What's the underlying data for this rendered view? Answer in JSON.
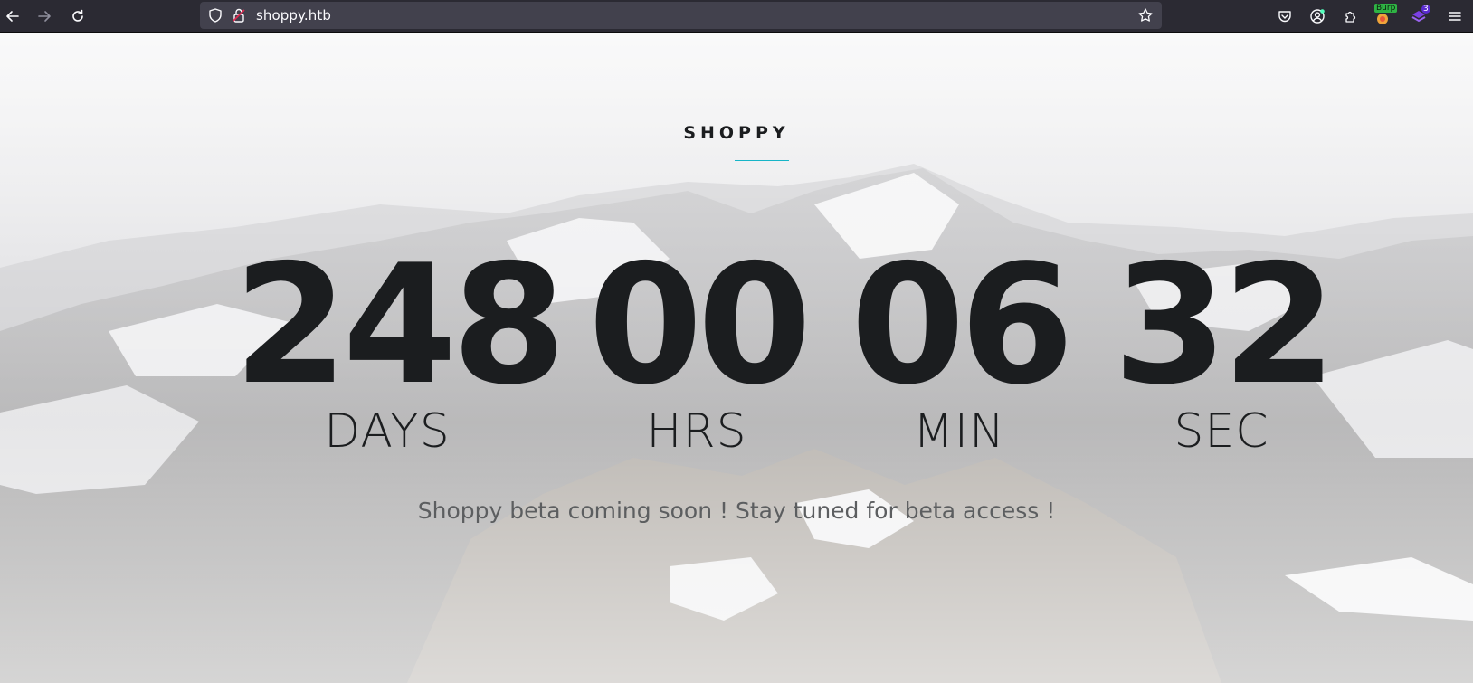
{
  "browser": {
    "url": "shoppy.htb",
    "extensions": [
      {
        "icon": "pocket-icon"
      },
      {
        "icon": "account-icon"
      },
      {
        "icon": "extensions-icon"
      },
      {
        "icon": "burp-extension-icon",
        "badge": "Burp"
      },
      {
        "icon": "wappalyzer-extension-icon",
        "badge": "3"
      }
    ],
    "colors": {
      "chrome": "#2b2a33",
      "urlbar": "#42414d",
      "text": "#fbfbfe"
    }
  },
  "page": {
    "brand": "SHOPPY",
    "countdown": [
      {
        "value": "248",
        "label": "DAYS"
      },
      {
        "value": "00",
        "label": "HRS"
      },
      {
        "value": "06",
        "label": "MIN"
      },
      {
        "value": "32",
        "label": "SEC"
      }
    ],
    "tagline": "Shoppy beta coming soon ! Stay tuned for beta access !",
    "colors": {
      "accent": "#17b5c7",
      "text": "#1b1d1f",
      "muted": "#5c5e60"
    }
  }
}
